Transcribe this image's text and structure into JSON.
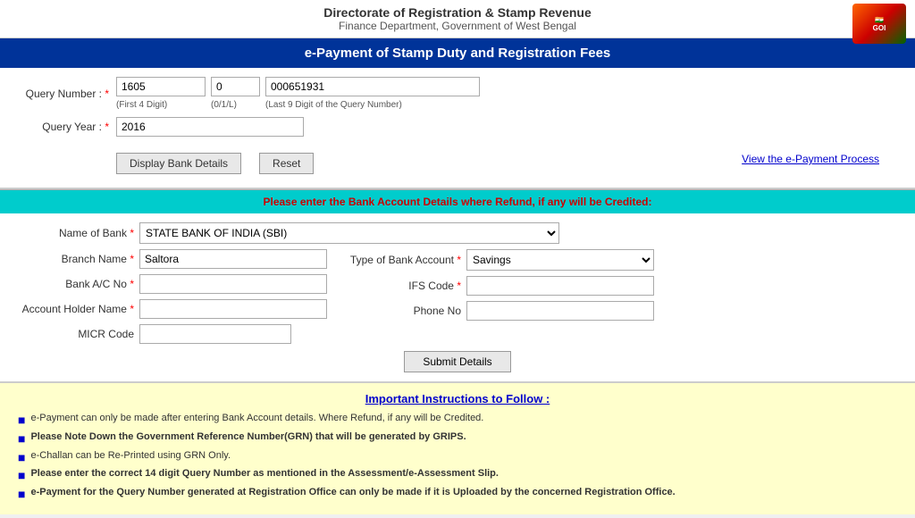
{
  "header": {
    "title": "Directorate of Registration & Stamp Revenue",
    "subtitle": "Finance Department, Government of West Bengal",
    "logo_text": "GOI"
  },
  "banner": {
    "main": "e-Payment of Stamp Duty and Registration Fees"
  },
  "query_form": {
    "query_number_label": "Query Number :",
    "query_year_label": "Query Year :",
    "required_marker": "*",
    "field1_value": "1605",
    "field1_hint": "(First 4 Digit)",
    "field2_value": "0",
    "field2_hint": "(0/1/L)",
    "field3_value": "000651931",
    "field3_hint": "(Last 9 Digit of the Query Number)",
    "year_value": "2016",
    "display_bank_btn": "Display Bank Details",
    "reset_btn": "Reset",
    "view_link": "View the e-Payment Process"
  },
  "bank_section": {
    "banner_text": "Please enter the Bank Account Details where Refund, if any will be Credited:",
    "name_of_bank_label": "Name of Bank",
    "branch_name_label": "Branch Name",
    "bank_ac_label": "Bank A/C No",
    "account_holder_label": "Account Holder Name",
    "micr_label": "MICR Code",
    "type_label": "Type of Bank Account",
    "ifs_label": "IFS Code",
    "phone_label": "Phone No",
    "bank_name_value": "STATE BANK OF INDIA (SBI)",
    "branch_name_value": "Saltora",
    "type_value": "Savings",
    "submit_btn": "Submit Details"
  },
  "instructions": {
    "title": "Important Instructions to Follow :",
    "items": [
      "e-Payment can only be made after entering Bank Account details. Where Refund, if any will be Credited.",
      "Please Note Down the Government Reference Number(GRN) that will be generated by GRIPS.",
      "e-Challan can be Re-Printed using GRN Only.",
      "Please enter the correct 14 digit Query Number as mentioned in the Assessment/e-Assessment Slip.",
      "e-Payment for the Query Number generated at Registration Office can only be made if it is Uploaded by the concerned Registration Office."
    ],
    "bold_items": [
      1,
      3,
      4
    ]
  }
}
